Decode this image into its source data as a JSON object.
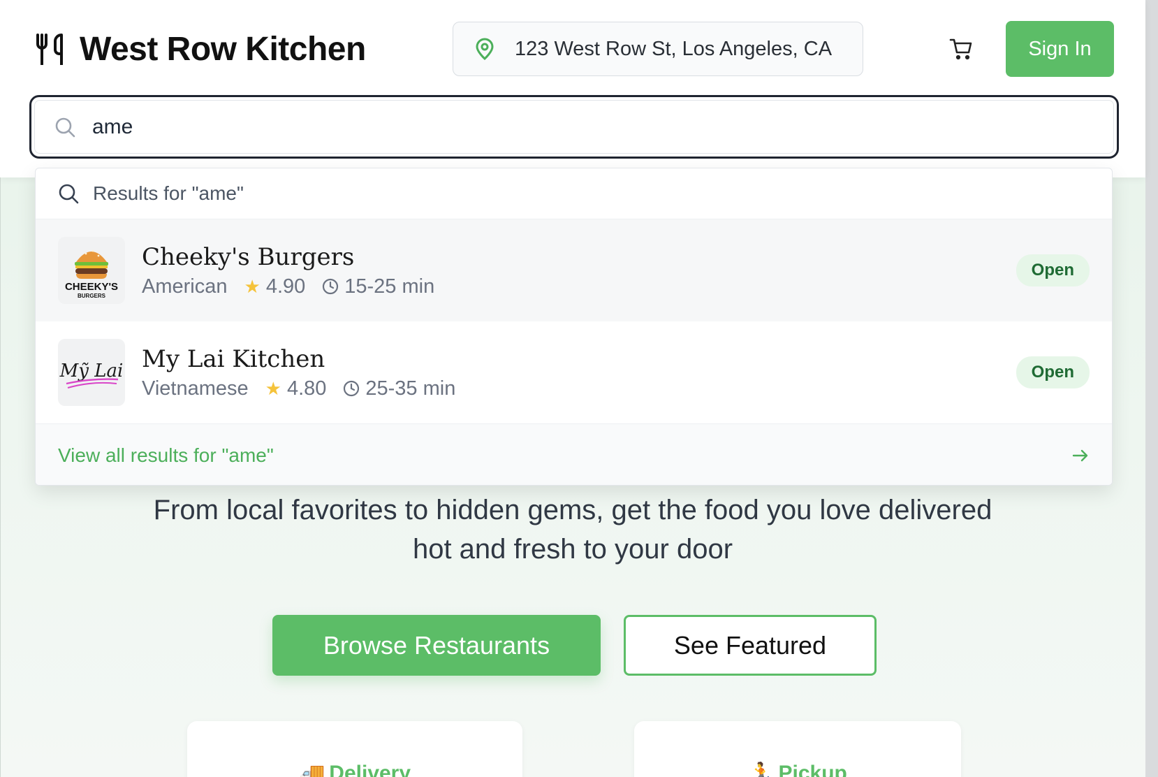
{
  "header": {
    "brand": "West Row Kitchen",
    "address": "123 West Row St, Los Angeles, CA",
    "sign_in_label": "Sign In"
  },
  "search": {
    "value": "ame",
    "results_header": "Results for \"ame\"",
    "results": [
      {
        "name": "Cheeky's Burgers",
        "cuisine": "American",
        "rating": "4.90",
        "time": "15-25 min",
        "status": "Open",
        "logo_text": "CHEEKY'S",
        "logo_subtext": "BURGERS"
      },
      {
        "name": "My Lai Kitchen",
        "cuisine": "Vietnamese",
        "rating": "4.80",
        "time": "25-35 min",
        "status": "Open",
        "logo_text": "Mỹ Lai"
      }
    ],
    "view_all": "View all results for \"ame\""
  },
  "hero": {
    "subtitle_line1": "From local favorites to hidden gems, get the food you love delivered",
    "subtitle_line2": "hot and fresh to your door",
    "browse_label": "Browse Restaurants",
    "featured_label": "See Featured"
  },
  "cards": {
    "delivery_icon": "🚚",
    "delivery": "Delivery",
    "pickup_icon": "🏃",
    "pickup": "Pickup"
  },
  "colors": {
    "accent": "#5cbd67",
    "badge_bg": "#e6f6e8",
    "badge_text": "#1f6b34",
    "star": "#f5c33b"
  }
}
